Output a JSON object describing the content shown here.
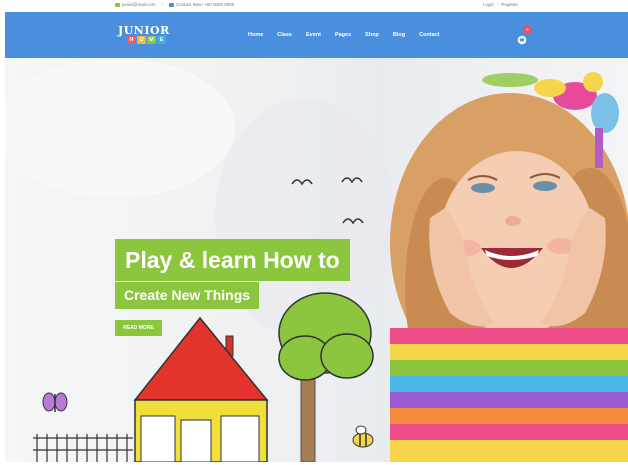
{
  "topbar": {
    "email": "junior@mail.com",
    "contact": "Contact Now: +00 0000 0000",
    "login": "Login",
    "divider": "/",
    "register": "Register"
  },
  "brand": {
    "word": "JUNIOR",
    "blocks": [
      "H",
      "O",
      "M",
      "E"
    ],
    "block_colors": [
      "#f05a5a",
      "#f7b731",
      "#8cc63f",
      "#3fb0e6"
    ]
  },
  "nav": {
    "items": [
      "Home",
      "Class",
      "Event",
      "Pages",
      "Shop",
      "Blog",
      "Contact"
    ]
  },
  "cart": {
    "icon": "cart-icon",
    "count": "0"
  },
  "hero": {
    "headline": "Play & learn How to",
    "subhead": "Create New Things",
    "cta": "READ MORE"
  },
  "colors": {
    "primary": "#4a8fde",
    "accent_green": "#8cc63f",
    "badge_red": "#ef4e5c"
  }
}
